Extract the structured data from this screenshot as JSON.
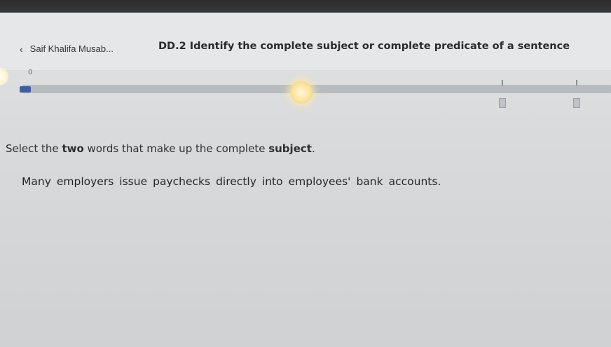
{
  "header": {
    "back_label": "Saif Khalifa Musab...",
    "skill_title": "DD.2 Identify the complete subject or complete predicate of a sentence"
  },
  "progress": {
    "small_label": "0",
    "fraction": 0.5
  },
  "question": {
    "prefix": "Select the ",
    "emphasis_count": "two",
    "middle": " words that make up the complete ",
    "emphasis_target": "subject",
    "suffix": "."
  },
  "sentence": {
    "words": [
      "Many",
      "employers",
      "issue",
      "paychecks",
      "directly",
      "into",
      "employees'",
      "bank",
      "accounts."
    ]
  },
  "icons": {
    "back": "chevron-left-icon"
  },
  "colors": {
    "progress_fill": "#3d5fa0",
    "knob": "#ffe7a8"
  }
}
